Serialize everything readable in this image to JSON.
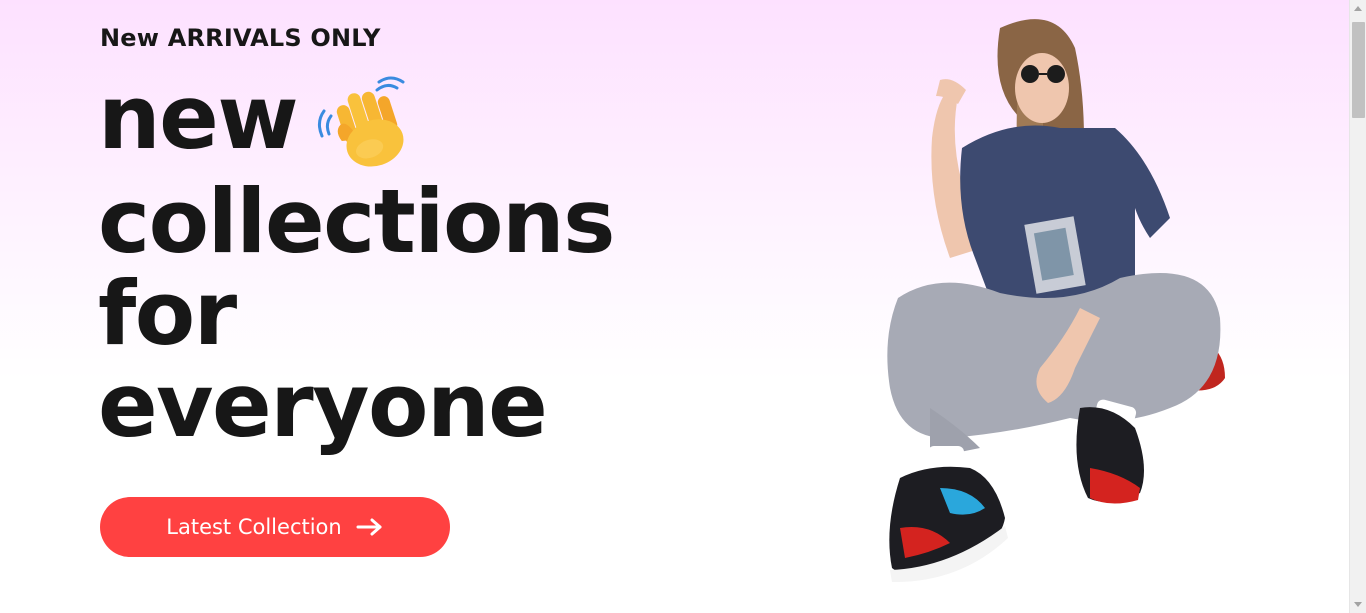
{
  "hero": {
    "eyebrow": "New ARRIVALS ONLY",
    "headline": {
      "line1": "new",
      "line2": "collections",
      "line3": "for",
      "line4": "everyone"
    },
    "wave_icon": "waving-hand-icon",
    "cta": {
      "label": "Latest Collection",
      "icon": "arrow-right-icon"
    },
    "image": "model-photo"
  },
  "colors": {
    "accent": "#ff4141",
    "text": "#171717",
    "bg_top": "#fde1ff",
    "bg_bottom": "#ffffff"
  }
}
